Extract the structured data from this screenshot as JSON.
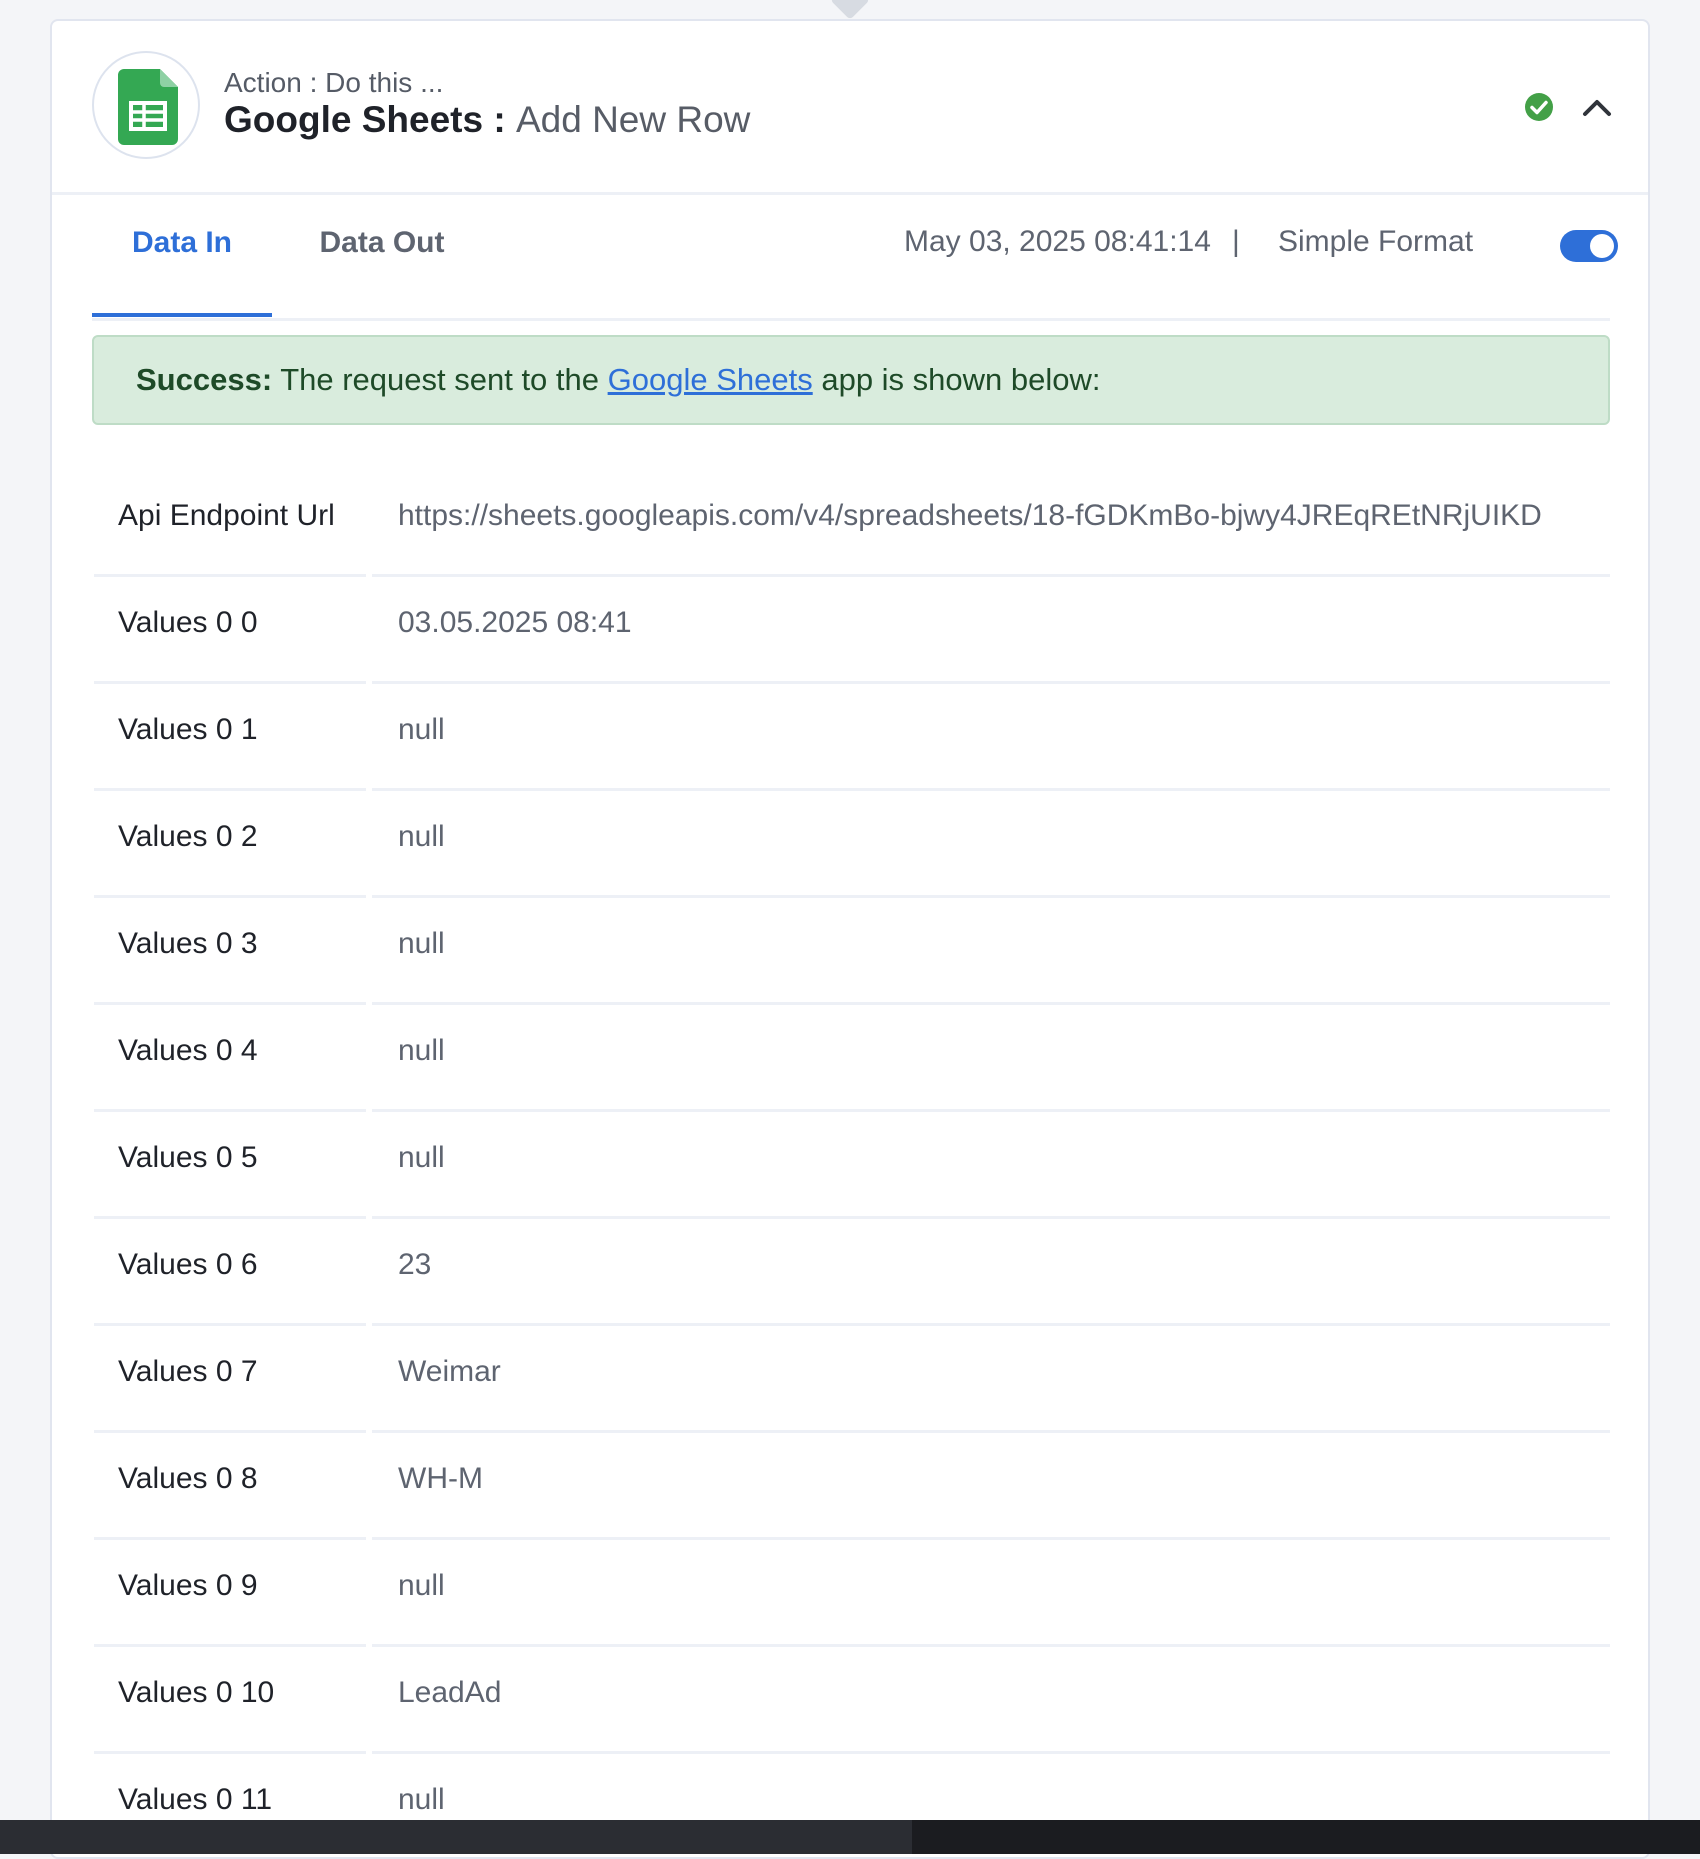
{
  "header": {
    "action_label": "Action : Do this ...",
    "app_name": "Google Sheets",
    "separator": " : ",
    "event_name": "Add New Row",
    "app_icon": "google-sheets-icon",
    "status_icon": "check-circle-icon",
    "collapse_icon": "chevron-up-icon"
  },
  "tabs": [
    {
      "label": "Data In",
      "active": true
    },
    {
      "label": "Data Out",
      "active": false
    }
  ],
  "meta": {
    "timestamp": "May 03, 2025 08:41:14",
    "divider": "|",
    "format_label": "Simple Format",
    "simple_format_on": true
  },
  "alert": {
    "strong": "Success:",
    "before_link": " The request sent to the ",
    "link": "Google Sheets",
    "after_link": " app is shown below:"
  },
  "rows": [
    {
      "key": "Api Endpoint Url",
      "value": "https://sheets.googleapis.com/v4/spreadsheets/18-fGDKmBo-bjwy4JREqREtNRjUIKD"
    },
    {
      "key": "Values 0 0",
      "value": "03.05.2025 08:41"
    },
    {
      "key": "Values 0 1",
      "value": "null"
    },
    {
      "key": "Values 0 2",
      "value": "null"
    },
    {
      "key": "Values 0 3",
      "value": "null"
    },
    {
      "key": "Values 0 4",
      "value": "null"
    },
    {
      "key": "Values 0 5",
      "value": "null"
    },
    {
      "key": "Values 0 6",
      "value": "23"
    },
    {
      "key": "Values 0 7",
      "value": "Weimar"
    },
    {
      "key": "Values 0 8",
      "value": "WH-M"
    },
    {
      "key": "Values 0 9",
      "value": "null"
    },
    {
      "key": "Values 0 10",
      "value": "LeadAd"
    },
    {
      "key": "Values 0 11",
      "value": "null"
    }
  ],
  "colors": {
    "accent": "#2e6fd8",
    "success_bg": "#d9ecdd",
    "success_text": "#1e4a28",
    "sheets_green": "#34a853"
  }
}
